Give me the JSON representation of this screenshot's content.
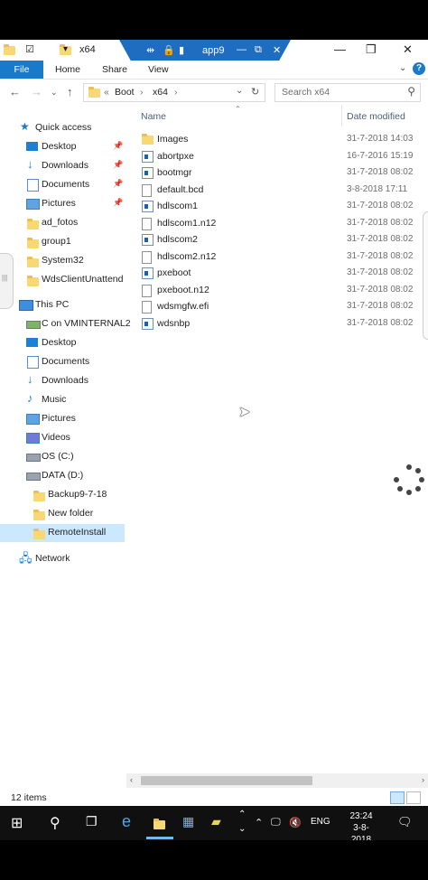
{
  "window": {
    "title": "x64",
    "rdp_title": "app9"
  },
  "ribbon": {
    "file": "File",
    "tabs": [
      "Home",
      "Share",
      "View"
    ]
  },
  "address": {
    "crumbs": [
      "«",
      "Boot",
      "›",
      "x64",
      "›"
    ],
    "search_placeholder": "Search x64"
  },
  "nav": {
    "quick_access": "Quick access",
    "quick_items": [
      "Desktop",
      "Downloads",
      "Documents",
      "Pictures"
    ],
    "folders": [
      "ad_fotos",
      "group1",
      "System32",
      "WdsClientUnattend"
    ],
    "this_pc": "This PC",
    "pc_items": [
      "C on VMINTERNAL2",
      "Desktop",
      "Documents",
      "Downloads",
      "Music",
      "Pictures",
      "Videos",
      "OS (C:)",
      "DATA (D:)"
    ],
    "data_children": [
      "Backup9-7-18",
      "New folder",
      "RemoteInstall"
    ],
    "network": "Network"
  },
  "columns": {
    "name": "Name",
    "date": "Date modified"
  },
  "files": [
    {
      "name": "Images",
      "date": "31-7-2018 14:03",
      "kind": "folder"
    },
    {
      "name": "abortpxe",
      "date": "16-7-2016 15:19",
      "kind": "app"
    },
    {
      "name": "bootmgr",
      "date": "31-7-2018 08:02",
      "kind": "app"
    },
    {
      "name": "default.bcd",
      "date": "3-8-2018 17:11",
      "kind": "file"
    },
    {
      "name": "hdlscom1",
      "date": "31-7-2018 08:02",
      "kind": "app"
    },
    {
      "name": "hdlscom1.n12",
      "date": "31-7-2018 08:02",
      "kind": "file"
    },
    {
      "name": "hdlscom2",
      "date": "31-7-2018 08:02",
      "kind": "app"
    },
    {
      "name": "hdlscom2.n12",
      "date": "31-7-2018 08:02",
      "kind": "file"
    },
    {
      "name": "pxeboot",
      "date": "31-7-2018 08:02",
      "kind": "app"
    },
    {
      "name": "pxeboot.n12",
      "date": "31-7-2018 08:02",
      "kind": "file"
    },
    {
      "name": "wdsmgfw.efi",
      "date": "31-7-2018 08:02",
      "kind": "file"
    },
    {
      "name": "wdsnbp",
      "date": "31-7-2018 08:02",
      "kind": "app"
    }
  ],
  "status": {
    "items": "12 items"
  },
  "taskbar": {
    "lang": "ENG",
    "time": "23:24",
    "date": "3-8-2018"
  }
}
